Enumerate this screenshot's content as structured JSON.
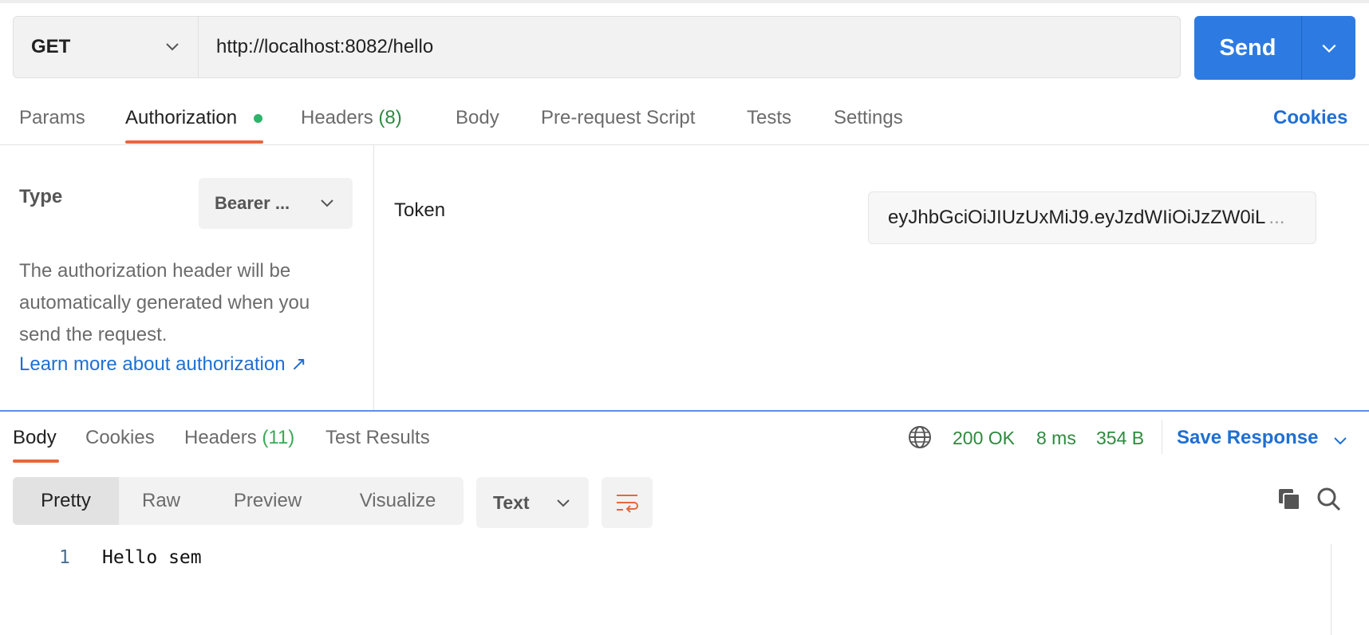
{
  "request": {
    "method": "GET",
    "url": "http://localhost:8082/hello",
    "send_label": "Send"
  },
  "request_tabs": {
    "params": "Params",
    "authorization": "Authorization",
    "headers": "Headers",
    "headers_count": "(8)",
    "body": "Body",
    "prerequest": "Pre-request Script",
    "tests": "Tests",
    "settings": "Settings",
    "cookies": "Cookies"
  },
  "auth": {
    "type_label": "Type",
    "type_value": "Bearer ...",
    "description": "The authorization header will be automatically generated when you send the request.",
    "learn_more": "Learn more about authorization ↗",
    "token_label": "Token",
    "token_value": "eyJhbGciOiJIUzUxMiJ9.eyJzdWIiOiJzZW0iL",
    "token_ellipsis": "..."
  },
  "response_tabs": {
    "body": "Body",
    "cookies": "Cookies",
    "headers": "Headers",
    "headers_count": "(11)",
    "test_results": "Test Results"
  },
  "response_meta": {
    "status": "200 OK",
    "time": "8 ms",
    "size": "354 B",
    "save_response": "Save Response"
  },
  "view": {
    "modes": [
      "Pretty",
      "Raw",
      "Preview",
      "Visualize"
    ],
    "format": "Text"
  },
  "code": {
    "line_number": "1",
    "line_text": "Hello sem"
  },
  "colors": {
    "accent_blue": "#2d7be2",
    "tab_underline": "#e8673c",
    "status_green": "#2d8a3e",
    "link_blue": "#1f6fd2"
  }
}
